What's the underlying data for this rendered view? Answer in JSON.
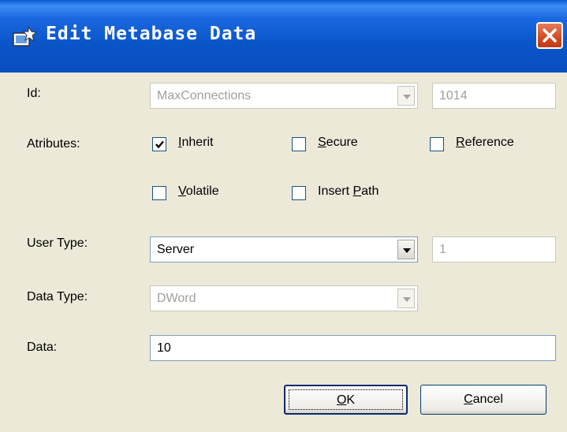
{
  "window": {
    "title": "Edit Metabase Data",
    "title_icon": "edit-metabase-wizard-icon",
    "close_icon": "close-icon"
  },
  "id_row": {
    "label": "Id:",
    "name_value": "MaxConnections",
    "number_value": "1014",
    "disabled": true
  },
  "attributes": {
    "label": "Atributes:",
    "items": [
      {
        "name": "Inherit",
        "accel": "I",
        "rest": "nherit",
        "checked": true
      },
      {
        "name": "Secure",
        "accel": "S",
        "rest": "ecure",
        "checked": false
      },
      {
        "name": "Reference",
        "accel": "R",
        "rest": "eference",
        "checked": false
      },
      {
        "name": "Volatile",
        "accel": "V",
        "rest": "olatile",
        "checked": false
      },
      {
        "name": "Insert Path",
        "pre": "Insert ",
        "accel": "P",
        "rest": "ath",
        "checked": false
      }
    ]
  },
  "user_type": {
    "label": "User Type:",
    "value": "Server",
    "number_value": "1"
  },
  "data_type": {
    "label": "Data Type:",
    "value": "DWord",
    "disabled": true
  },
  "data": {
    "label": "Data:",
    "value": "10"
  },
  "buttons": {
    "ok": {
      "accel": "O",
      "rest": "K"
    },
    "cancel": {
      "accel": "C",
      "rest": "ancel"
    }
  },
  "colors": {
    "titlebar": "#0a55c9",
    "dialog_bg": "#ece9d8",
    "close_button": "#d24a23",
    "disabled_text": "#a09f98"
  }
}
